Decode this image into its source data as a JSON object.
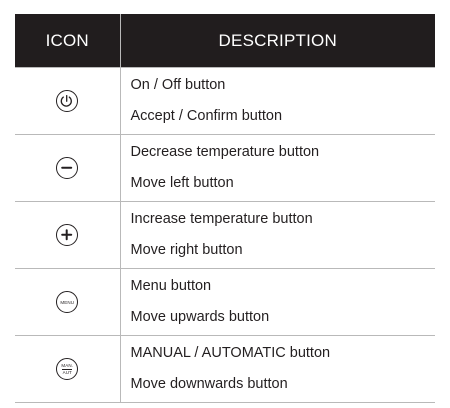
{
  "table": {
    "header": {
      "icon_col": "ICON",
      "desc_col": "DESCRIPTION"
    },
    "rows": [
      {
        "icon": "power-icon",
        "lines": [
          "On / Off button",
          "Accept / Confirm button"
        ]
      },
      {
        "icon": "minus-icon",
        "lines": [
          "Decrease temperature button",
          "Move left button"
        ]
      },
      {
        "icon": "plus-icon",
        "lines": [
          "Increase temperature button",
          "Move right button"
        ]
      },
      {
        "icon": "menu-icon",
        "icon_text": "MENU",
        "lines": [
          "Menu button",
          "Move upwards button"
        ]
      },
      {
        "icon": "manual-auto-icon",
        "icon_text_top": "MAN.",
        "icon_text_bottom": "AUT",
        "lines": [
          "MANUAL / AUTOMATIC button",
          "Move downwards button"
        ]
      }
    ]
  }
}
